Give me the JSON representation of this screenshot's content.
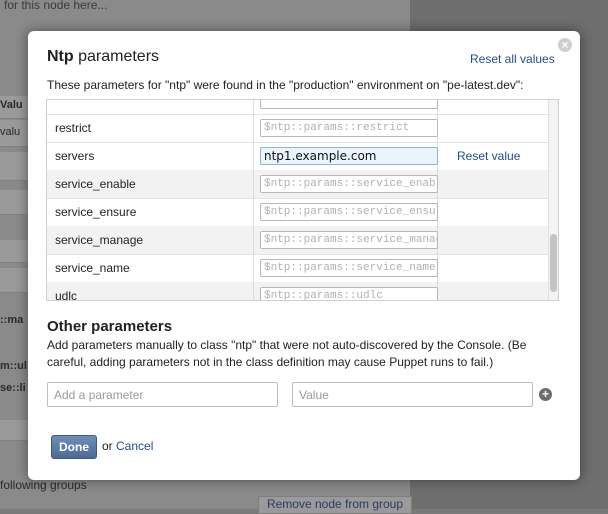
{
  "background": {
    "top_text": "for this node here...",
    "labels": [
      "Valu",
      "valu",
      "::ma",
      "m::ul",
      "se::li"
    ],
    "following_groups": "following groups",
    "remove_button": "Remove node from group"
  },
  "modal": {
    "title_bold": "Ntp",
    "title_rest": " parameters",
    "reset_all": "Reset all values",
    "found_text": "These parameters for \"ntp\" were found in the \"production\" environment on \"pe-latest.dev\":",
    "rows": [
      {
        "name": "restrict",
        "placeholder": "$ntp::params::restrict",
        "value": "",
        "reset": ""
      },
      {
        "name": "servers",
        "placeholder": "",
        "value": "ntp1.example.com",
        "reset": "Reset value"
      },
      {
        "name": "service_enable",
        "placeholder": "$ntp::params::service_enable",
        "value": "",
        "reset": ""
      },
      {
        "name": "service_ensure",
        "placeholder": "$ntp::params::service_ensure",
        "value": "",
        "reset": ""
      },
      {
        "name": "service_manage",
        "placeholder": "$ntp::params::service_manage",
        "value": "",
        "reset": ""
      },
      {
        "name": "service_name",
        "placeholder": "$ntp::params::service_name",
        "value": "",
        "reset": ""
      },
      {
        "name": "udlc",
        "placeholder": "$ntp::params::udlc",
        "value": "",
        "reset": ""
      }
    ],
    "other_title": "Other parameters",
    "other_desc": "Add parameters manually to class \"ntp\" that were not auto-discovered by the Console. (Be careful, adding parameters not in the class definition may cause Puppet runs to fail.)",
    "add_param_placeholder": "Add a parameter",
    "value_placeholder": "Value",
    "done": "Done",
    "or": "or",
    "cancel": "Cancel"
  }
}
